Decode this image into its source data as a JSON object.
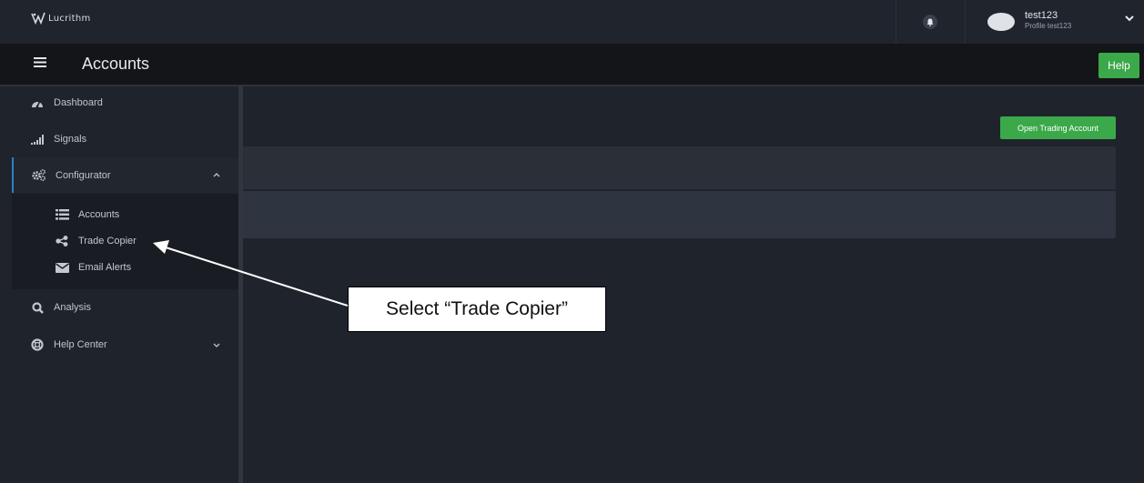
{
  "app": {
    "logo_text": "Lucrithm"
  },
  "topbar": {
    "user_name": "test123",
    "user_profile": "Profile test123"
  },
  "header": {
    "title": "Accounts",
    "help_label": "Help"
  },
  "sidebar": {
    "items": [
      {
        "label": "Dashboard",
        "icon": "dashboard-icon"
      },
      {
        "label": "Signals",
        "icon": "signal-bars-icon"
      },
      {
        "label": "Configurator",
        "icon": "cogs-icon",
        "expanded": true
      },
      {
        "label": "Analysis",
        "icon": "search-icon"
      },
      {
        "label": "Help Center",
        "icon": "life-ring-icon"
      }
    ],
    "configurator_children": [
      {
        "label": "Accounts",
        "icon": "list-icon"
      },
      {
        "label": "Trade Copier",
        "icon": "share-icon"
      },
      {
        "label": "Email Alerts",
        "icon": "envelope-icon"
      }
    ]
  },
  "main": {
    "open_account_label": "Open Trading Account"
  },
  "annotation": {
    "callout_text": "Select “Trade Copier”"
  },
  "colors": {
    "background": "#1f232c",
    "header": "#131518",
    "accent_green": "#3ba84a",
    "active_border": "#2c7fbf"
  }
}
